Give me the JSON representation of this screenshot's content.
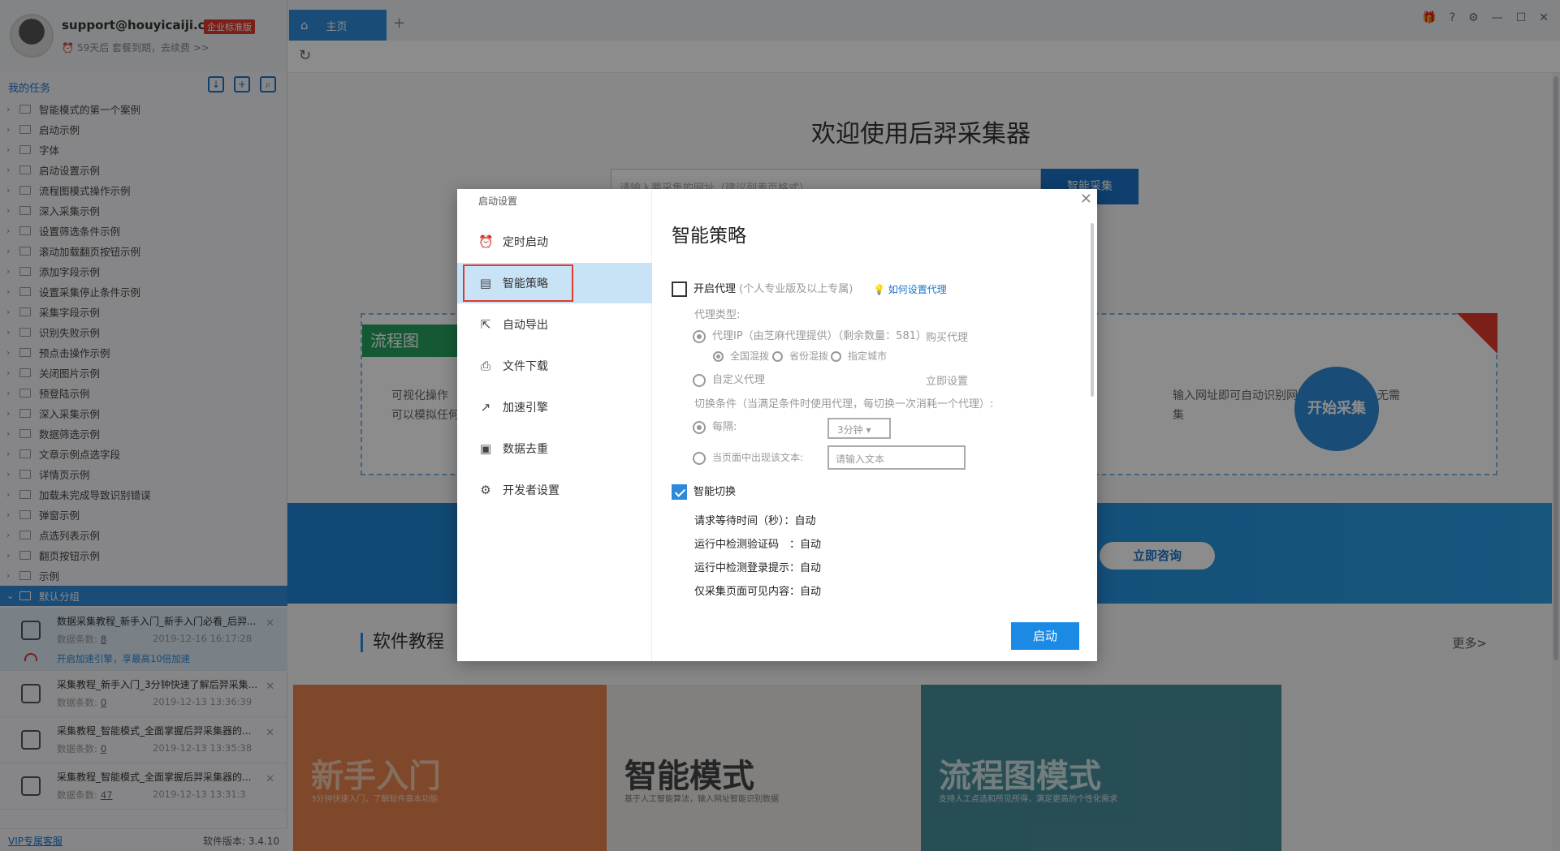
{
  "sidebar": {
    "email": "support@houyicaiji.c...",
    "edition": "企业标准版",
    "expiry": "59天后 套餐到期，去续费 >>",
    "tasks_title": "我的任务",
    "tree": [
      "智能模式的第一个案例",
      "启动示例",
      "字体",
      "启动设置示例",
      "流程图模式操作示例",
      "深入采集示例",
      "设置筛选条件示例",
      "滚动加载翻页按钮示例",
      "添加字段示例",
      "设置采集停止条件示例",
      "采集字段示例",
      "识别失败示例",
      "预点击操作示例",
      "关闭图片示例",
      "预登陆示例",
      "深入采集示例",
      "数据筛选示例",
      "文章示例点选字段",
      "详情页示例",
      "加载未完成导致识别错误",
      "弹窗示例",
      "点选列表示例",
      "翻页按钮示例",
      "示例"
    ],
    "default_group": "默认分组",
    "tasks": [
      {
        "title": "数据采集教程_新手入门_新手入门必看_后羿...",
        "meta": "数据条数:",
        "count": "8",
        "time": "2019-12-16 16:17:28",
        "accel": "开启加速引擎，享最高10倍加速"
      },
      {
        "title": "采集教程_新手入门_3分钟快速了解后羿采集...",
        "meta": "数据条数:",
        "count": "0",
        "time": "2019-12-13 13:36:39"
      },
      {
        "title": "采集教程_智能模式_全面掌握后羿采集器的...",
        "meta": "数据条数:",
        "count": "0",
        "time": "2019-12-13 13:35:38"
      },
      {
        "title": "采集教程_智能模式_全面掌握后羿采集器的...",
        "meta": "数据条数:",
        "count": "47",
        "time": "2019-12-13 13:31:3"
      }
    ],
    "vip": "VIP专属客服",
    "version": "软件版本: 3.4.10"
  },
  "topbar": {
    "tab_home": "主页"
  },
  "main": {
    "welcome": "欢迎使用后羿采集器",
    "search_placeholder": "请输入要采集的网址（建议列表页格式）",
    "search_btn": "智能采集",
    "flow_badge": "流程图",
    "feature_desc_1": "可视化操作",
    "feature_desc_2": "可以模拟任何",
    "feature_right_1": "输入网址即可自动识别网页内容和分页，无需",
    "feature_right_2": "集",
    "start_btn": "开始采集",
    "consult": "立即咨询",
    "tutorial_title": "软件教程",
    "more": "更多>",
    "thumbs": [
      {
        "title": "新手入门",
        "sub": "3分钟快速入门，了解软件基本功能"
      },
      {
        "title": "智能模式",
        "sub": "基于人工智能算法，输入网址智能识别数据"
      },
      {
        "title": "流程图模式",
        "sub": "支持人工点选和所见所得，满足更高的个性化需求"
      }
    ]
  },
  "modal": {
    "title": "启动设置",
    "nav": [
      "定时启动",
      "智能策略",
      "自动导出",
      "文件下载",
      "加速引擎",
      "数据去重",
      "开发者设置"
    ],
    "heading": "智能策略",
    "proxy_label": "开启代理",
    "proxy_note": "(个人专业版及以上专属)",
    "proxy_help": "如何设置代理",
    "proxy_type": "代理类型:",
    "proxy_ip": "代理IP（由芝麻代理提供）（剩余数量：581）",
    "buy_proxy": "购买代理",
    "opt_mixed_all": "全国混拨",
    "opt_mixed_prov": "省份混拨",
    "opt_city": "指定城市",
    "custom_proxy": "自定义代理",
    "set_now": "立即设置",
    "switch_cond": "切换条件（当满足条件时使用代理，每切换一次消耗一个代理）:",
    "every": "每隔:",
    "interval": "3分钟",
    "on_text": "当页面中出现该文本:",
    "text_placeholder": "请输入文本",
    "smart_switch": "智能切换",
    "wait_time": "请求等待时间（秒）：自动",
    "captcha": "运行中检测验证码　：自动",
    "login_prompt": "运行中检测登录提示：自动",
    "visible_only": "仅采集页面可见内容：自动",
    "launch": "启动"
  }
}
